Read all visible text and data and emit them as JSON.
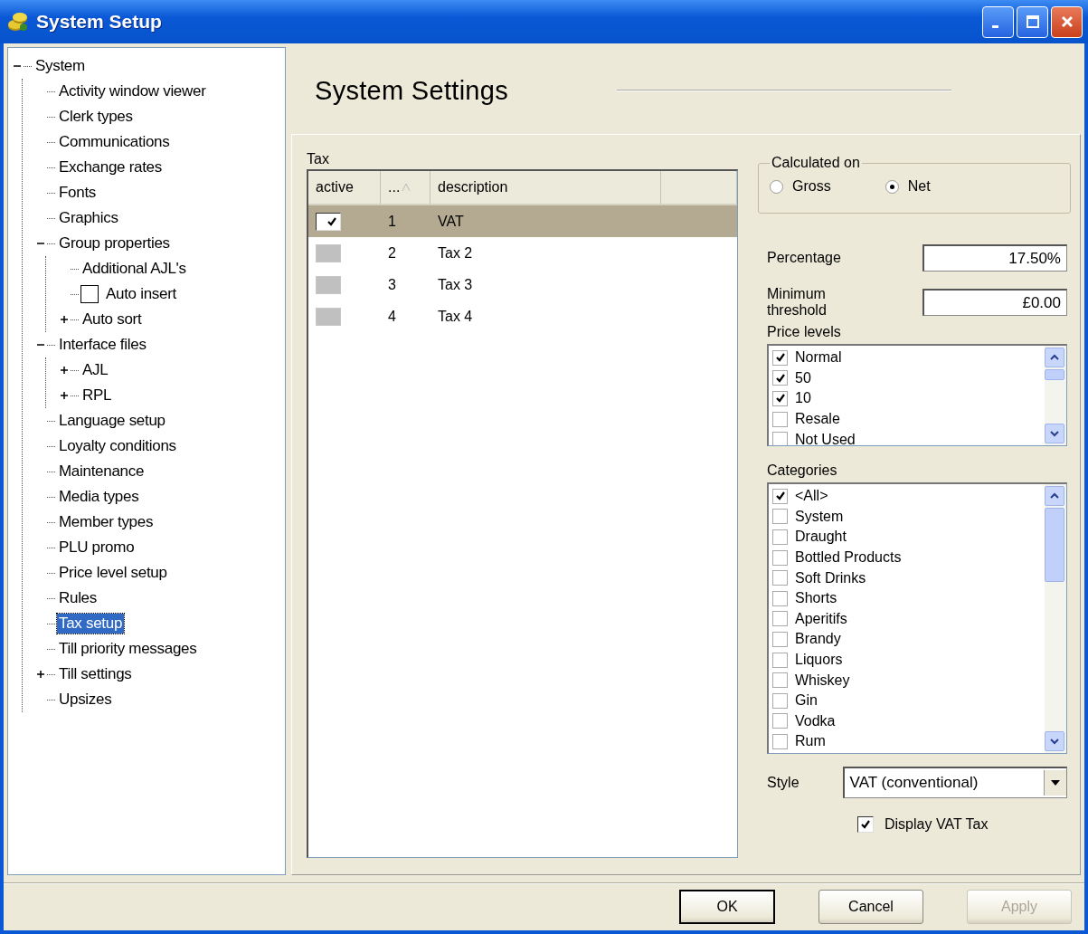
{
  "window": {
    "title": "System Setup"
  },
  "tree": [
    {
      "label": "System",
      "expanded": true,
      "selected": false,
      "children": [
        {
          "label": "Activity window viewer",
          "selected": false
        },
        {
          "label": "Clerk types",
          "selected": false
        },
        {
          "label": "Communications",
          "selected": false
        },
        {
          "label": "Exchange rates",
          "selected": false
        },
        {
          "label": "Fonts",
          "selected": false
        },
        {
          "label": "Graphics",
          "selected": false
        },
        {
          "label": "Group properties",
          "expanded": true,
          "selected": false,
          "children": [
            {
              "label": "Additional AJL's",
              "selected": false
            },
            {
              "label": "Auto insert",
              "checked": false,
              "selected": false
            },
            {
              "label": "Auto sort",
              "expanded": false,
              "selected": false
            }
          ]
        },
        {
          "label": "Interface files",
          "expanded": true,
          "selected": false,
          "children": [
            {
              "label": "AJL",
              "expanded": false,
              "selected": false
            },
            {
              "label": "RPL",
              "expanded": false,
              "selected": false
            }
          ]
        },
        {
          "label": "Language setup",
          "selected": false
        },
        {
          "label": "Loyalty conditions",
          "selected": false
        },
        {
          "label": "Maintenance",
          "selected": false
        },
        {
          "label": "Media types",
          "selected": false
        },
        {
          "label": "Member types",
          "selected": false
        },
        {
          "label": "PLU promo",
          "selected": false
        },
        {
          "label": "Price level setup",
          "selected": false
        },
        {
          "label": "Rules",
          "selected": false
        },
        {
          "label": "Tax setup",
          "selected": true
        },
        {
          "label": "Till priority messages",
          "selected": false
        },
        {
          "label": "Till settings",
          "expanded": false,
          "selected": false
        },
        {
          "label": "Upsizes",
          "selected": false
        }
      ]
    }
  ],
  "header": {
    "title": "System Settings"
  },
  "tax": {
    "label": "Tax",
    "columns": [
      "active",
      "...",
      "description"
    ],
    "rows": [
      {
        "active": true,
        "number": "1",
        "description": "VAT",
        "selected": true
      },
      {
        "active": false,
        "number": "2",
        "description": "Tax 2",
        "selected": false
      },
      {
        "active": false,
        "number": "3",
        "description": "Tax 3",
        "selected": false
      },
      {
        "active": false,
        "number": "4",
        "description": "Tax 4",
        "selected": false
      }
    ]
  },
  "calculated_on": {
    "label": "Calculated on",
    "options": [
      {
        "label": "Gross",
        "selected": false
      },
      {
        "label": "Net",
        "selected": true
      }
    ]
  },
  "percentage": {
    "label": "Percentage",
    "value": "17.50%"
  },
  "minimum_threshold": {
    "label": "Minimum threshold",
    "value": "£0.00"
  },
  "price_levels": {
    "label": "Price levels",
    "items": [
      {
        "label": "Normal",
        "checked": true
      },
      {
        "label": "50",
        "checked": true
      },
      {
        "label": "10",
        "checked": true
      },
      {
        "label": "Resale",
        "checked": false
      },
      {
        "label": "Not Used",
        "checked": false
      }
    ]
  },
  "categories": {
    "label": "Categories",
    "items": [
      {
        "label": "<All>",
        "checked": true
      },
      {
        "label": "System",
        "checked": false
      },
      {
        "label": "Draught",
        "checked": false
      },
      {
        "label": "Bottled Products",
        "checked": false
      },
      {
        "label": "Soft Drinks",
        "checked": false
      },
      {
        "label": "Shorts",
        "checked": false
      },
      {
        "label": "Aperitifs",
        "checked": false
      },
      {
        "label": "Brandy",
        "checked": false
      },
      {
        "label": "Liquors",
        "checked": false
      },
      {
        "label": "Whiskey",
        "checked": false
      },
      {
        "label": "Gin",
        "checked": false
      },
      {
        "label": "Vodka",
        "checked": false
      },
      {
        "label": "Rum",
        "checked": false
      }
    ]
  },
  "style": {
    "label": "Style",
    "value": "VAT (conventional)"
  },
  "display_vat_tax": {
    "label": "Display VAT Tax",
    "checked": true
  },
  "buttons": [
    {
      "label": "OK",
      "default": true,
      "disabled": false
    },
    {
      "label": "Cancel",
      "default": false,
      "disabled": false
    },
    {
      "label": "Apply",
      "default": false,
      "disabled": true
    }
  ]
}
